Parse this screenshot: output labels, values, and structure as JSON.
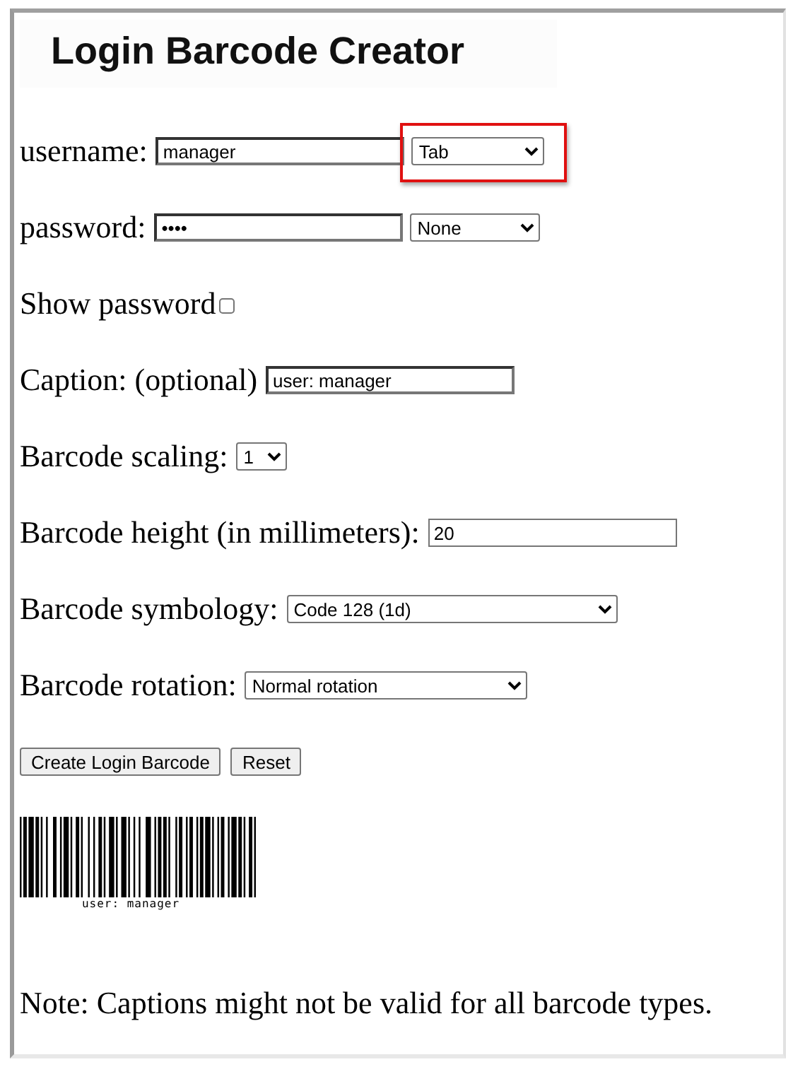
{
  "title": "Login Barcode Creator",
  "rows": [
    {
      "kind": "text",
      "label": "username:",
      "value": "manager",
      "select": {
        "value": "Tab",
        "highlighted": true
      }
    },
    {
      "kind": "text",
      "label": "password:",
      "value": "••••",
      "select": {
        "value": "None",
        "highlighted": false
      }
    },
    {
      "kind": "checkbox",
      "label": "Show password",
      "checked": false
    },
    {
      "kind": "text",
      "label": "Caption: (optional)",
      "value": "user: manager"
    },
    {
      "kind": "select",
      "label": "Barcode scaling:",
      "value": "1"
    },
    {
      "kind": "text",
      "label": "Barcode height (in millimeters):",
      "value": "20"
    },
    {
      "kind": "select",
      "label": "Barcode symbology:",
      "value": "Code 128 (1d)"
    },
    {
      "kind": "select",
      "label": "Barcode rotation:",
      "value": "Normal rotation"
    }
  ],
  "buttons": [
    "Create Login Barcode",
    "Reset"
  ],
  "barcode": {
    "caption": "user: manager"
  },
  "note": "Note: Captions might not be valid for all barcode types."
}
